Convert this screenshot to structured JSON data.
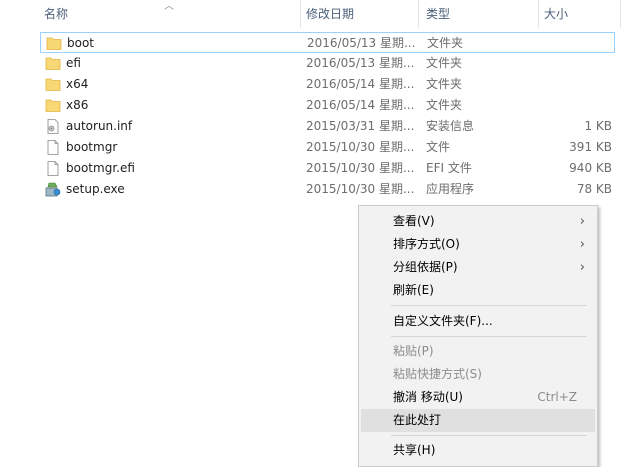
{
  "columns": {
    "name": "名称",
    "date": "修改日期",
    "type": "类型",
    "size": "大小"
  },
  "files": [
    {
      "name": "boot",
      "date": "2016/05/13 星期...",
      "type": "文件夹",
      "size": "",
      "icon": "folder-icon"
    },
    {
      "name": "efi",
      "date": "2016/05/13 星期...",
      "type": "文件夹",
      "size": "",
      "icon": "folder-icon"
    },
    {
      "name": "x64",
      "date": "2016/05/14 星期...",
      "type": "文件夹",
      "size": "",
      "icon": "folder-icon"
    },
    {
      "name": "x86",
      "date": "2016/05/14 星期...",
      "type": "文件夹",
      "size": "",
      "icon": "folder-icon"
    },
    {
      "name": "autorun.inf",
      "date": "2015/03/31 星期...",
      "type": "安装信息",
      "size": "1 KB",
      "icon": "inf-file-icon"
    },
    {
      "name": "bootmgr",
      "date": "2015/10/30 星期...",
      "type": "文件",
      "size": "391 KB",
      "icon": "file-icon"
    },
    {
      "name": "bootmgr.efi",
      "date": "2015/10/30 星期...",
      "type": "EFI 文件",
      "size": "940 KB",
      "icon": "file-icon"
    },
    {
      "name": "setup.exe",
      "date": "2015/10/30 星期...",
      "type": "应用程序",
      "size": "78 KB",
      "icon": "setup-exe-icon"
    }
  ],
  "context_menu": {
    "view": "查看(V)",
    "sort": "排序方式(O)",
    "group": "分组依据(P)",
    "refresh": "刷新(E)",
    "customize": "自定义文件夹(F)...",
    "paste": "粘贴(P)",
    "paste_shortcut": "粘贴快捷方式(S)",
    "undo": "撤消 移动(U)",
    "undo_shortcut": "Ctrl+Z",
    "open_here": "在此处打",
    "share": "共享(H)"
  },
  "colors": {
    "folder": "#f8d775",
    "folder_dark": "#e4b443",
    "focus_border": "#99d1ff",
    "menu_bg": "#f2f2f2",
    "menu_hover": "#e0e0e0"
  }
}
